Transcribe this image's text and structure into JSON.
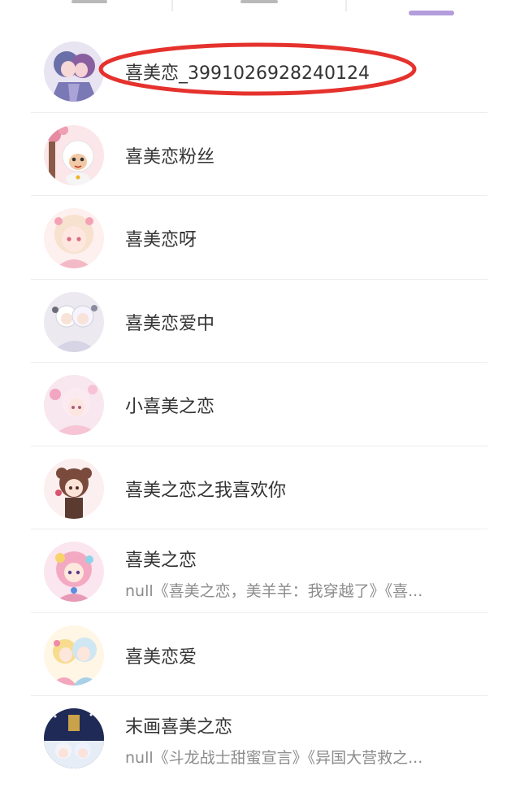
{
  "colors": {
    "accent": "#b39ddb",
    "highlight_ellipse": "#e5322d",
    "divider": "#ededed",
    "name_text": "#333333",
    "sub_text": "#8c8c8c"
  },
  "results": [
    {
      "name": "喜美恋_3991026928240124",
      "subtitle": "",
      "avatar": "anime-couple-avatar",
      "highlighted": true
    },
    {
      "name": "喜美恋粉丝",
      "subtitle": "",
      "avatar": "pleasant-goat-avatar",
      "highlighted": false
    },
    {
      "name": "喜美恋呀",
      "subtitle": "",
      "avatar": "anime-girl-pink-avatar",
      "highlighted": false
    },
    {
      "name": "喜美恋爱中",
      "subtitle": "",
      "avatar": "anime-sheep-pair-avatar",
      "highlighted": false
    },
    {
      "name": "小喜美之恋",
      "subtitle": "",
      "avatar": "anime-girl-flowers-avatar",
      "highlighted": false
    },
    {
      "name": "喜美之恋之我喜欢你",
      "subtitle": "",
      "avatar": "anime-brown-hair-avatar",
      "highlighted": false
    },
    {
      "name": "喜美之恋",
      "subtitle": "null《喜美之恋，美羊羊：我穿越了》《喜...",
      "avatar": "anime-colorful-avatar",
      "highlighted": false
    },
    {
      "name": "喜美恋爱",
      "subtitle": "",
      "avatar": "anime-couple-yellow-avatar",
      "highlighted": false
    },
    {
      "name": "末画喜美之恋",
      "subtitle": "null《斗龙战士甜蜜宣言》《异国大营救之...",
      "avatar": "anime-night-avatar",
      "highlighted": false
    }
  ]
}
